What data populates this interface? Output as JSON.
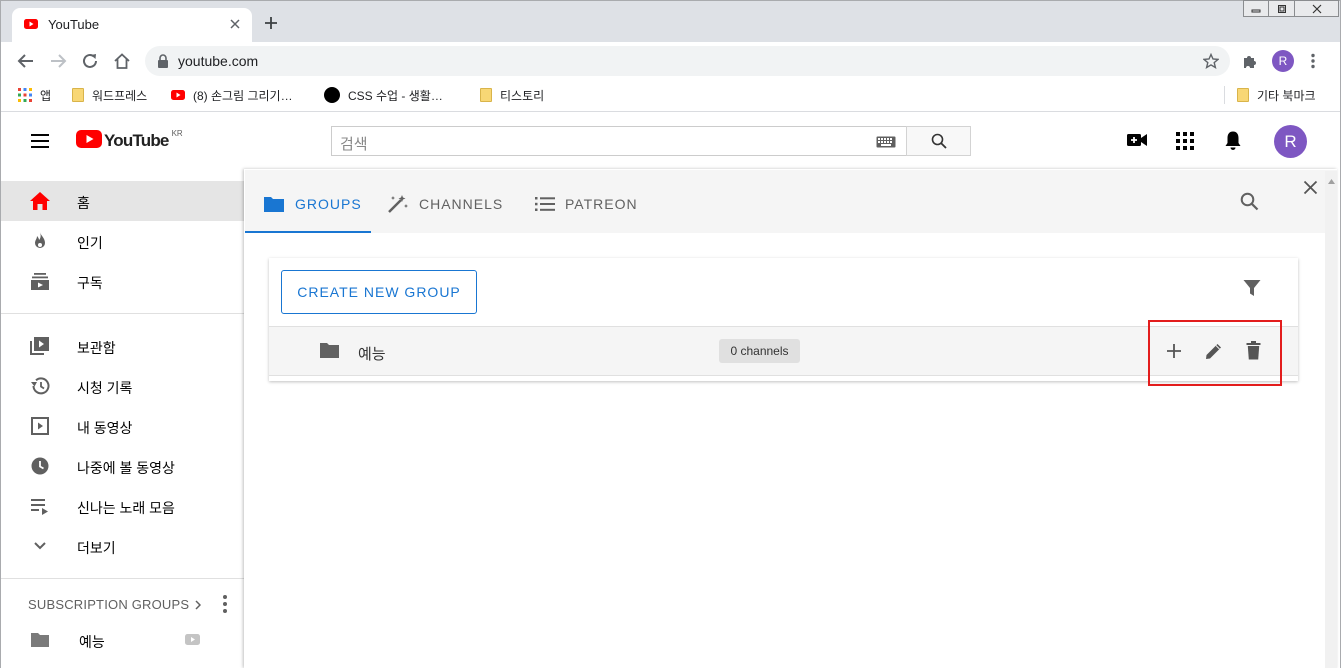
{
  "browser": {
    "tab_title": "YouTube",
    "url": "youtube.com",
    "profile_initial": "R",
    "bookmarks": [
      {
        "label": "앱",
        "icon": "apps-grid-icon"
      },
      {
        "label": "워드프레스",
        "icon": "folder-icon"
      },
      {
        "label": "(8) 손그림 그리기…",
        "icon": "youtube-icon"
      },
      {
        "label": "CSS 수업 - 생활…",
        "icon": "circle-icon"
      },
      {
        "label": "티스토리",
        "icon": "folder-icon"
      },
      {
        "label": "기타 북마크",
        "icon": "folder-icon"
      }
    ]
  },
  "youtube": {
    "logo_text": "YouTube",
    "logo_region": "KR",
    "search_placeholder": "검색",
    "avatar_initial": "R",
    "accent": "#ff0000"
  },
  "sidebar": {
    "items": [
      {
        "label": "홈",
        "icon": "home-icon",
        "active": true
      },
      {
        "label": "인기",
        "icon": "trending-fire-icon"
      },
      {
        "label": "구독",
        "icon": "subscriptions-icon"
      },
      {
        "label": "보관함",
        "icon": "library-icon"
      },
      {
        "label": "시청 기록",
        "icon": "history-icon"
      },
      {
        "label": "내 동영상",
        "icon": "your-videos-icon"
      },
      {
        "label": "나중에 볼 동영상",
        "icon": "watch-later-icon"
      },
      {
        "label": "신나는 노래 모음",
        "icon": "playlist-icon"
      },
      {
        "label": "더보기",
        "icon": "chevron-down-icon"
      }
    ],
    "subscription_groups_title": "SUBSCRIPTION GROUPS",
    "subscription_groups": [
      {
        "label": "예능",
        "icon": "folder-icon"
      }
    ]
  },
  "panel": {
    "tabs": [
      {
        "label": "GROUPS",
        "icon": "folder-icon",
        "active": true
      },
      {
        "label": "CHANNELS",
        "icon": "magic-wand-icon"
      },
      {
        "label": "PATREON",
        "icon": "list-icon"
      }
    ],
    "create_button": "CREATE NEW GROUP",
    "groups": [
      {
        "name": "예능",
        "channels": "0 channels"
      }
    ],
    "accent": "#1976d2",
    "highlight_color": "#e31d1d"
  }
}
